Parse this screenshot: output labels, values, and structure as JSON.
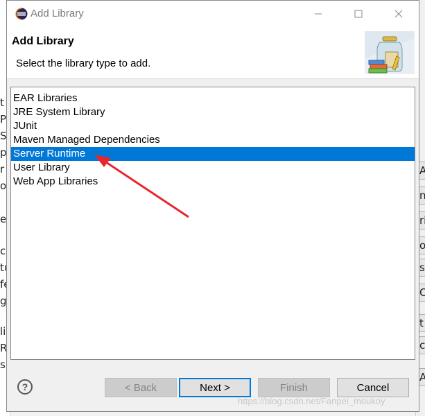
{
  "window": {
    "title": "Add Library",
    "minimize_icon": "minimize-icon",
    "maximize_icon": "maximize-icon",
    "close_icon": "close-icon"
  },
  "header": {
    "title": "Add Library",
    "description": "Select the library type to add."
  },
  "library_types": [
    {
      "label": "EAR Libraries",
      "selected": false
    },
    {
      "label": "JRE System Library",
      "selected": false
    },
    {
      "label": "JUnit",
      "selected": false
    },
    {
      "label": "Maven Managed Dependencies",
      "selected": false
    },
    {
      "label": "Server Runtime",
      "selected": true
    },
    {
      "label": "User Library",
      "selected": false
    },
    {
      "label": "Web App Libraries",
      "selected": false
    }
  ],
  "buttons": {
    "help": "?",
    "back": "< Back",
    "next": "Next >",
    "finish": "Finish",
    "cancel": "Cancel"
  },
  "background_fragments": {
    "left": [
      "t",
      "P",
      "S",
      "pi",
      "r",
      "oc",
      "er",
      "ce",
      "tu",
      "fe",
      "g",
      "li",
      "Ru",
      "si"
    ],
    "right": [
      "A",
      "n",
      "ri",
      "o",
      "s",
      "C",
      "t",
      "c",
      "A"
    ]
  },
  "watermark": "https://blog.csdn.net/Fanpei_moukoy",
  "colors": {
    "selection": "#0078d7",
    "annotation_arrow": "#e8262d"
  }
}
